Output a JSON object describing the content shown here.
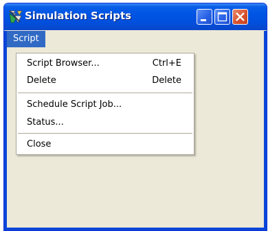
{
  "window": {
    "title": "Simulation Scripts",
    "icon": "simulation-app-icon",
    "controls": {
      "minimize_icon": "minimize-icon",
      "maximize_icon": "maximize-icon",
      "close_icon": "close-icon"
    },
    "colors": {
      "titlebar": "#0054e3",
      "face": "#ece9d8",
      "menu_highlight": "#316ac5",
      "close_button": "#d8532f"
    }
  },
  "menubar": {
    "items": [
      {
        "label": "Script",
        "open": true
      }
    ]
  },
  "dropdown": {
    "items": [
      {
        "label": "Script Browser...",
        "shortcut": "Ctrl+E"
      },
      {
        "label": "Delete",
        "shortcut": "Delete"
      },
      {
        "label": "Schedule Script Job...",
        "shortcut": ""
      },
      {
        "label": "Status...",
        "shortcut": ""
      },
      {
        "label": "Close",
        "shortcut": ""
      }
    ]
  }
}
